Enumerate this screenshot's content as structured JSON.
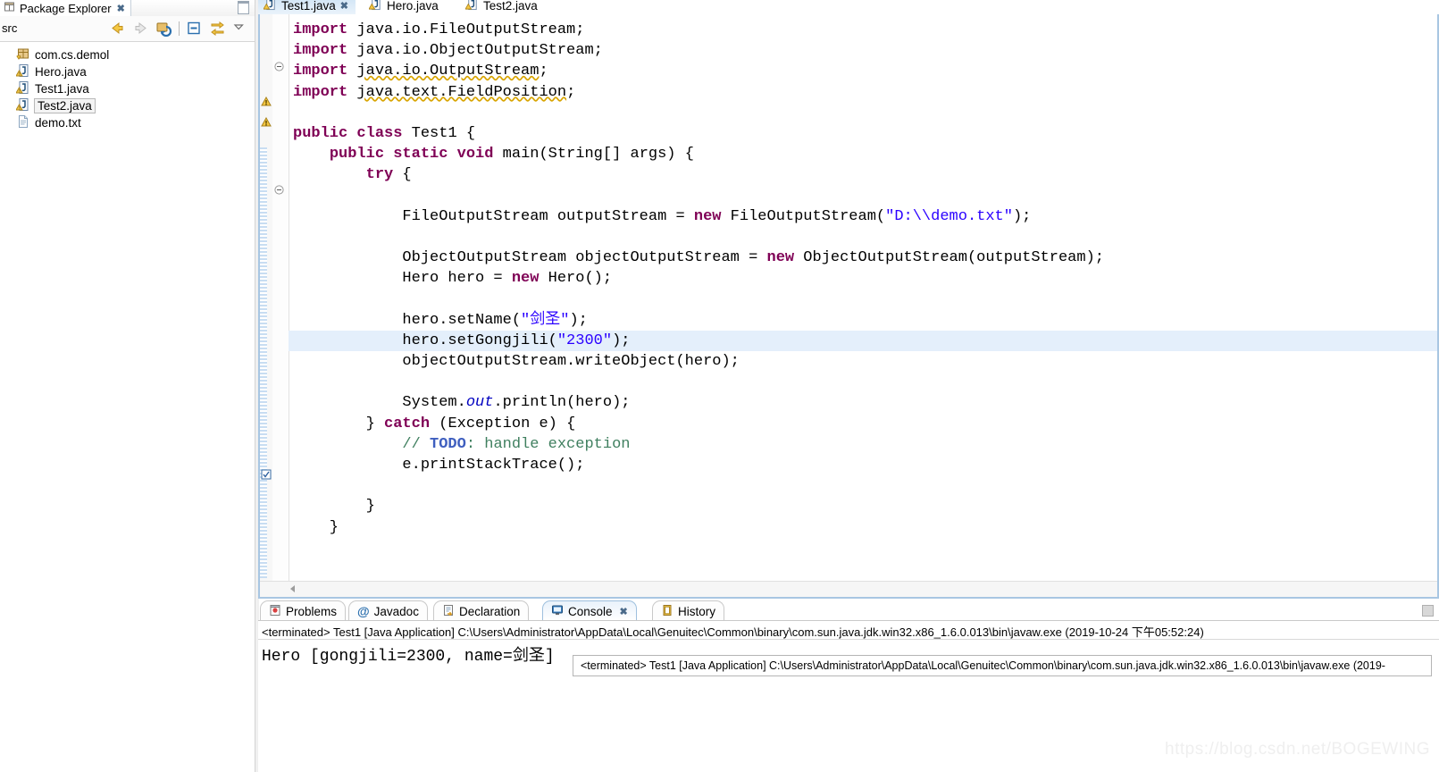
{
  "explorer": {
    "tab_title": "Package Explorer",
    "close_glyph": "✖",
    "src_label": "src",
    "toolbar_icons": [
      "back-arrow-icon",
      "forward-arrow-icon",
      "collapse-to-package-icon",
      "collapse-all-icon",
      "link-with-editor-icon",
      "view-menu-icon"
    ],
    "tree": [
      {
        "label": "com.cs.demol",
        "icon": "package-icon",
        "indent": 0,
        "selected": false
      },
      {
        "label": "Hero.java",
        "icon": "java-file-warning-icon",
        "indent": 1,
        "selected": false
      },
      {
        "label": "Test1.java",
        "icon": "java-file-warning-icon",
        "indent": 1,
        "selected": false
      },
      {
        "label": "Test2.java",
        "icon": "java-file-warning-icon",
        "indent": 1,
        "selected": true
      },
      {
        "label": "demo.txt",
        "icon": "text-file-icon",
        "indent": 1,
        "selected": false
      }
    ]
  },
  "editor": {
    "tabs": [
      {
        "label": "Test1.java",
        "active": true,
        "closeable": true
      },
      {
        "label": "Hero.java",
        "active": false,
        "closeable": false
      },
      {
        "label": "Test2.java",
        "active": false,
        "closeable": false
      }
    ],
    "code_lines": [
      {
        "html": "<span class=\"kw\">import</span> java.io.FileOutputStream;",
        "fold": true,
        "marker": ""
      },
      {
        "html": "<span class=\"kw\">import</span> java.io.ObjectOutputStream;",
        "fold": false,
        "marker": ""
      },
      {
        "html": "<span class=\"kw\">import</span> <span class=\"wav\">java.io.OutputStream</span>;",
        "fold": false,
        "marker": "warning"
      },
      {
        "html": "<span class=\"kw\">import</span> <span class=\"wav\">java.text.FieldPosition</span>;",
        "fold": false,
        "marker": "warning"
      },
      {
        "html": "",
        "fold": false,
        "marker": ""
      },
      {
        "html": "<span class=\"kw\">public</span> <span class=\"kw\">class</span> Test1 {",
        "fold": false,
        "marker": ""
      },
      {
        "html": "    <span class=\"kw\">public</span> <span class=\"kw\">static</span> <span class=\"kw\">void</span> main(String[] args) {",
        "fold": true,
        "marker": ""
      },
      {
        "html": "        <span class=\"kw\">try</span> {",
        "fold": false,
        "marker": ""
      },
      {
        "html": "",
        "fold": false,
        "marker": ""
      },
      {
        "html": "            FileOutputStream outputStream = <span class=\"kw\">new</span> FileOutputStream(<span class=\"str\">\"D:\\\\demo.txt\"</span>);",
        "fold": false,
        "marker": ""
      },
      {
        "html": "",
        "fold": false,
        "marker": ""
      },
      {
        "html": "            ObjectOutputStream objectOutputStream = <span class=\"kw\">new</span> ObjectOutputStream(outputStream);",
        "fold": false,
        "marker": ""
      },
      {
        "html": "            Hero hero = <span class=\"kw\">new</span> Hero();",
        "fold": false,
        "marker": ""
      },
      {
        "html": "",
        "fold": false,
        "marker": ""
      },
      {
        "html": "            hero.setName(<span class=\"str\">\"剑圣\"</span>);",
        "fold": false,
        "marker": ""
      },
      {
        "html": "            hero.setGongjili(<span class=\"str\">\"2300\"</span>);",
        "fold": false,
        "marker": "",
        "highlight": true
      },
      {
        "html": "            objectOutputStream.writeObject(hero);",
        "fold": false,
        "marker": ""
      },
      {
        "html": "",
        "fold": false,
        "marker": ""
      },
      {
        "html": "            System.<span class=\"stc\">out</span>.println(hero);",
        "fold": false,
        "marker": ""
      },
      {
        "html": "        } <span class=\"kw\">catch</span> (Exception e) {",
        "fold": false,
        "marker": ""
      },
      {
        "html": "            <span class=\"cmt\">// <span class=\"tdo\">TODO</span>: handle exception</span>",
        "fold": false,
        "marker": "task"
      },
      {
        "html": "            e.printStackTrace();",
        "fold": false,
        "marker": ""
      },
      {
        "html": "",
        "fold": false,
        "marker": ""
      },
      {
        "html": "        }",
        "fold": false,
        "marker": ""
      },
      {
        "html": "    }",
        "fold": false,
        "marker": ""
      }
    ]
  },
  "bottom_view": {
    "tabs": [
      {
        "label": "Problems",
        "icon": "problems-icon",
        "active": false,
        "closeable": false
      },
      {
        "label": "Javadoc",
        "icon": "javadoc-at-icon",
        "active": false,
        "closeable": false
      },
      {
        "label": "Declaration",
        "icon": "declaration-icon",
        "active": false,
        "closeable": false
      },
      {
        "label": "Console",
        "icon": "console-icon",
        "active": true,
        "closeable": true
      },
      {
        "label": "History",
        "icon": "history-icon",
        "active": false,
        "closeable": false
      }
    ],
    "close_glyph": "✖",
    "console_header": "<terminated> Test1 [Java Application] C:\\Users\\Administrator\\AppData\\Local\\Genuitec\\Common\\binary\\com.sun.java.jdk.win32.x86_1.6.0.013\\bin\\javaw.exe (2019-10-24 下午05:52:24)",
    "console_output": "Hero [gongjili=2300, name=剑圣]"
  },
  "tooltip": {
    "text": "<terminated> Test1 [Java Application] C:\\Users\\Administrator\\AppData\\Local\\Genuitec\\Common\\binary\\com.sun.java.jdk.win32.x86_1.6.0.013\\bin\\javaw.exe (2019-"
  },
  "watermark": {
    "text": "https://blog.csdn.net/BOGEWING"
  },
  "colors": {
    "keyword": "#7F0055",
    "string": "#2A00FF",
    "comment": "#3F7F5F",
    "todo": "#3F5FBF",
    "selection_line": "#E4EFFB",
    "tab_active": "#CFE3F5"
  }
}
